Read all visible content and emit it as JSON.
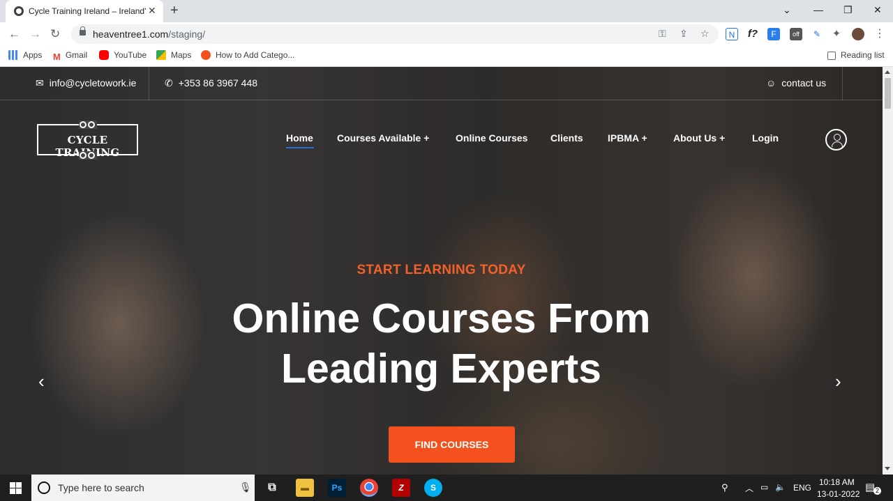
{
  "browser": {
    "tab_title": "Cycle Training Ireland – Ireland's",
    "url_host": "heaventree1.com",
    "url_path": "/staging/",
    "bookmarks": [
      {
        "label": "Apps",
        "icon": "apps-grid-icon",
        "color": "#4285f4"
      },
      {
        "label": "Gmail",
        "icon": "gmail-icon",
        "color": "#ea4335"
      },
      {
        "label": "YouTube",
        "icon": "youtube-icon",
        "color": "#ff0000"
      },
      {
        "label": "Maps",
        "icon": "maps-icon",
        "color": "#34a853"
      },
      {
        "label": "How to Add Catego...",
        "icon": "bookmark-site-icon",
        "color": "#f4511e"
      }
    ],
    "reading_list": "Reading list"
  },
  "site": {
    "email": "info@cycletowork.ie",
    "phone": "+353 86 3967 448",
    "contact": "contact us",
    "logo_text": "CYCLE TRAINING",
    "nav": [
      {
        "label": "Home",
        "active": true
      },
      {
        "label": "Courses Available +"
      },
      {
        "label": "Online Courses"
      },
      {
        "label": "Clients"
      },
      {
        "label": "IPBMA +"
      },
      {
        "label": "About Us +"
      },
      {
        "label": "Login"
      }
    ],
    "hero": {
      "kicker": "START LEARNING TODAY",
      "headline_line1": "Online Courses From",
      "headline_line2": "Leading Experts",
      "cta": "FIND COURSES",
      "prev": "‹",
      "next": "›"
    },
    "colors": {
      "accent": "#f4511e",
      "kicker": "#f2612a",
      "nav_active": "#2a6fd6"
    }
  },
  "taskbar": {
    "search_placeholder": "Type here to search",
    "language": "ENG",
    "time": "10:18 AM",
    "date": "13-01-2022",
    "notifications": "2"
  }
}
